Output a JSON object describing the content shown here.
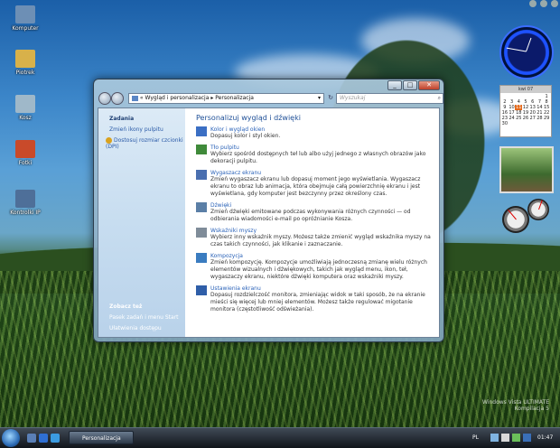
{
  "desktop": {
    "icons": [
      {
        "label": "Komputer",
        "icon": "computer-icon",
        "color": "#6d8fb5"
      },
      {
        "label": "Piotrek",
        "icon": "user-folder-icon",
        "color": "#d8b14a"
      },
      {
        "label": "Kosz",
        "icon": "recycle-bin-icon",
        "color": "#9fb8c9"
      },
      {
        "label": "Fotki",
        "icon": "photo-folder-icon",
        "color": "#c94a2a"
      },
      {
        "label": "Kontrolki IP",
        "icon": "network-icon",
        "color": "#4e6f99"
      }
    ]
  },
  "window": {
    "controls": {
      "minimize": "_",
      "maximize": "□",
      "close": "✕"
    },
    "address": {
      "icon": "control-panel-icon",
      "prefix": "«",
      "crumb1": "Wygląd i personalizacja",
      "separator": "▸",
      "crumb2": "Personalizacja",
      "dropdown": "▾"
    },
    "refresh": "↻",
    "search": {
      "placeholder": "Wyszukaj",
      "icon": "⌕"
    },
    "sidebar": {
      "heading": "Zadania",
      "links": [
        "Zmień ikony pulpitu",
        "Dostosuj rozmiar czcionki (DPI)"
      ],
      "see_also_heading": "Zobacz też",
      "see_also_links": [
        "Pasek zadań i menu Start",
        "Ułatwienia dostępu"
      ]
    },
    "main": {
      "title": "Personalizuj wygląd i dźwięki",
      "items": [
        {
          "title": "Kolor i wygląd okien",
          "desc": "Dopasuj kolor i styl okien.",
          "icon_color": "#3b6fc4"
        },
        {
          "title": "Tło pulpitu",
          "desc": "Wybierz spośród dostępnych teł lub albo użyj jednego z własnych obrazów jako dekoracji pulpitu.",
          "icon_color": "#3f8a3a"
        },
        {
          "title": "Wygaszacz ekranu",
          "desc": "Zmień wygaszacz ekranu lub dopasuj moment jego wyświetlania. Wygaszacz ekranu to obraz lub animacja, która obejmuje całą powierzchnię ekranu i jest wyświetlana, gdy komputer jest bezczynny przez określony czas.",
          "icon_color": "#4a6fb0"
        },
        {
          "title": "Dźwięki",
          "desc": "Zmień dźwięki emitowane podczas wykonywania różnych czynności — od odbierania wiadomości e-mail po opróżnianie Kosza.",
          "icon_color": "#5b7fa6"
        },
        {
          "title": "Wskaźniki myszy",
          "desc": "Wybierz inny wskaźnik myszy. Możesz także zmienić wygląd wskaźnika myszy na czas takich czynności, jak klikanie i zaznaczanie.",
          "icon_color": "#7f8c99"
        },
        {
          "title": "Kompozycja",
          "desc": "Zmień kompozycję. Kompozycje umożliwiają jednoczesną zmianę wielu różnych elementów wizualnych i dźwiękowych, takich jak wygląd menu, ikon, teł, wygaszaczy ekranu, niektóre dźwięki komputera oraz wskaźniki myszy.",
          "icon_color": "#3a7cc0"
        },
        {
          "title": "Ustawienia ekranu",
          "desc": "Dopasuj rozdzielczość monitora, zmieniając widok w taki sposób, że na ekranie mieści się więcej lub mniej elementów. Możesz także regulować migotanie monitora (częstotliwość odświeżania).",
          "icon_color": "#2f5ea8"
        }
      ]
    }
  },
  "calendar": {
    "month": "kwi 07",
    "days": [
      "",
      "",
      "",
      "",
      "",
      "",
      "1",
      "2",
      "3",
      "4",
      "5",
      "6",
      "7",
      "8",
      "9",
      "10",
      "11",
      "12",
      "13",
      "14",
      "15",
      "16",
      "17",
      "18",
      "19",
      "20",
      "21",
      "22",
      "23",
      "24",
      "25",
      "26",
      "27",
      "28",
      "29",
      "30"
    ],
    "today": "11"
  },
  "watermark": {
    "line1": "Windows Vista ULTIMATE",
    "line2": "Kompilacja 5"
  },
  "taskbar": {
    "window_button": "Personalizacja",
    "language": "PL",
    "time": "01:47"
  }
}
